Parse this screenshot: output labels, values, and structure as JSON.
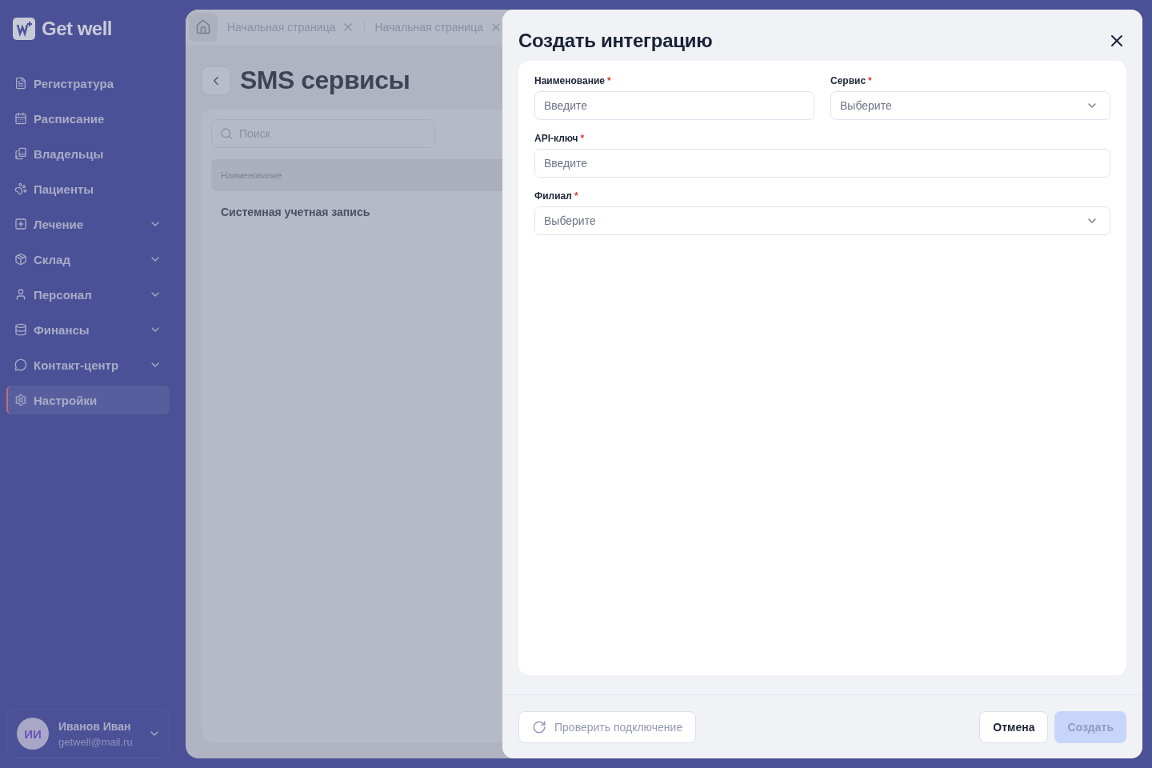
{
  "logo": {
    "text": "Get well"
  },
  "sidebar": {
    "items": [
      {
        "label": "Регистратура",
        "expandable": false,
        "selected": false
      },
      {
        "label": "Расписание",
        "expandable": false,
        "selected": false
      },
      {
        "label": "Владельцы",
        "expandable": false,
        "selected": false
      },
      {
        "label": "Пациенты",
        "expandable": false,
        "selected": false
      },
      {
        "label": "Лечение",
        "expandable": true,
        "selected": false
      },
      {
        "label": "Склад",
        "expandable": true,
        "selected": false
      },
      {
        "label": "Персонал",
        "expandable": true,
        "selected": false
      },
      {
        "label": "Финансы",
        "expandable": true,
        "selected": false
      },
      {
        "label": "Контакт-центр",
        "expandable": true,
        "selected": false
      },
      {
        "label": "Настройки",
        "expandable": false,
        "selected": true
      }
    ],
    "user": {
      "initials": "ИИ",
      "name": "Иванов Иван",
      "email": "getwell@mail.ru"
    }
  },
  "tabs": [
    {
      "label": "Начальная страница",
      "selected": false
    },
    {
      "label": "Начальная страница",
      "selected": false
    }
  ],
  "page": {
    "title": "SMS сервисы",
    "search": {
      "placeholder": "Поиск"
    },
    "table": {
      "columns": [
        "Наименование"
      ],
      "rows": [
        [
          "Системная учетная запись"
        ]
      ]
    }
  },
  "dialog": {
    "title": "Создать интеграцию",
    "fields": [
      {
        "label": "Наименование",
        "required_mark": "*",
        "kind": "input",
        "placeholder": "Введите"
      },
      {
        "label": "Сервис",
        "required_mark": "*",
        "kind": "select",
        "placeholder": "Выберите"
      },
      {
        "label": "API-ключ",
        "required_mark": "*",
        "kind": "input",
        "placeholder": "Введите"
      },
      {
        "label": "Филиал",
        "required_mark": "*",
        "kind": "select",
        "placeholder": "Выберите"
      }
    ],
    "buttons": [
      {
        "label": "Проверить подключение",
        "kind": "check",
        "disabled": true
      },
      {
        "label": "Отмена",
        "kind": "secondary",
        "disabled": false
      },
      {
        "label": "Создать",
        "kind": "primary",
        "disabled": true
      }
    ]
  }
}
